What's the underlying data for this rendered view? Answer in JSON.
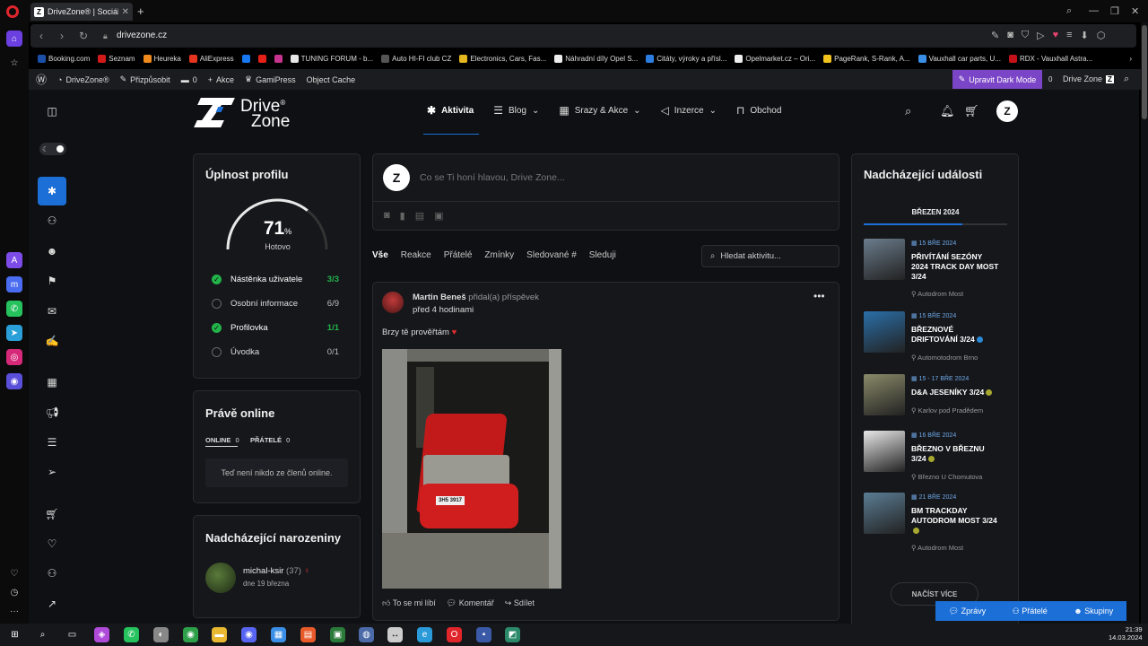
{
  "browser": {
    "tab_title": "DriveZone® | Sociální síť",
    "url": "drivezone.cz",
    "bookmarks": [
      {
        "label": "Booking.com",
        "color": "#1b4fa8"
      },
      {
        "label": "Seznam",
        "color": "#d21a1a"
      },
      {
        "label": "Heureka",
        "color": "#f08a1c"
      },
      {
        "label": "AliExpress",
        "color": "#e6341f"
      },
      {
        "label": "",
        "color": "#1877f2"
      },
      {
        "label": "",
        "color": "#e62117"
      },
      {
        "label": "",
        "color": "#c8338f"
      },
      {
        "label": "TUNING FORUM - b...",
        "color": "#e6e6e6"
      },
      {
        "label": "Auto HI-FI club CZ",
        "color": "#555"
      },
      {
        "label": "Electronics, Cars, Fas...",
        "color": "#e6b81f"
      },
      {
        "label": "Náhradní díly Opel S...",
        "color": "#eee"
      },
      {
        "label": "Citáty, výroky a přísl...",
        "color": "#2b7de0"
      },
      {
        "label": "Opelmarket.cz – Ori...",
        "color": "#eee"
      },
      {
        "label": "PageRank, S-Rank, A...",
        "color": "#f2c21d"
      },
      {
        "label": "Vauxhall car parts, U...",
        "color": "#3a8ee6"
      },
      {
        "label": "RDX - Vauxhall Astra...",
        "color": "#c4121a"
      }
    ]
  },
  "wpbar": {
    "site_name": "DriveZone®",
    "customize": "Přizpůsobit",
    "comments": "0",
    "new": "Akce",
    "gamipress": "GamiPress",
    "object_cache": "Object Cache",
    "dark_mode": "Upravit Dark Mode",
    "count": "0",
    "user": "Drive Zone"
  },
  "logo": {
    "line1": "Drive",
    "line2": "Zone",
    "reg": "®"
  },
  "nav": {
    "activity": "Aktivita",
    "blog": "Blog",
    "events": "Srazy & Akce",
    "ads": "Inzerce",
    "shop": "Obchod"
  },
  "profile_completion": {
    "title": "Úplnost profilu",
    "percent": 71,
    "percent_sign": "%",
    "done_label": "Hotovo",
    "items": [
      {
        "label": "Nástěnka uživatele",
        "count": "3/3",
        "done": true
      },
      {
        "label": "Osobní informace",
        "count": "6/9",
        "done": false
      },
      {
        "label": "Profilovka",
        "count": "1/1",
        "done": true
      },
      {
        "label": "Úvodka",
        "count": "0/1",
        "done": false
      }
    ]
  },
  "online": {
    "title": "Právě online",
    "tab_online": "ONLINE",
    "tab_online_count": "0",
    "tab_friends": "PŘÁTELÉ",
    "tab_friends_count": "0",
    "empty": "Teď není nikdo ze členů online."
  },
  "birthdays": {
    "title": "Nadcházející narozeniny",
    "name": "michal-ksir",
    "age": "(37)",
    "date": "dne 19 března"
  },
  "composer": {
    "placeholder": "Co se Ti honí hlavou, Drive Zone..."
  },
  "feed_tabs": [
    "Vše",
    "Reakce",
    "Přátelé",
    "Zmínky",
    "Sledované #",
    "Sleduji"
  ],
  "feed_search": "Hledat aktivitu...",
  "post": {
    "author": "Martin Beneš",
    "action": "přidal(a) příspěvek",
    "time": "před 4 hodinami",
    "text": "Brzy tě prověřtám",
    "plate": "3H5 3917",
    "like": "To se mi líbí",
    "comment": "Komentář",
    "share": "Sdílet"
  },
  "events": {
    "title": "Nadcházející události",
    "month": "BŘEZEN 2024",
    "more": "NAČÍST VÍCE",
    "items": [
      {
        "date": "15 BŘE 2024",
        "name": "PŘIVÍTÁNÍ SEZÓNY 2024 TRACK DAY MOST 3/24",
        "location": "Autodrom Most",
        "color": "#6b7c8c"
      },
      {
        "date": "15 BŘE 2024",
        "name": "BŘEZNOVÉ DRIFTOVÁNÍ 3/24",
        "location": "Automotodrom Brno",
        "color": "#2a6fa8"
      },
      {
        "date": "15 - 17 BŘE 2024",
        "name": "D&A JESENÍKY 3/24",
        "location": "Karlov pod Pradědem",
        "color": "#8a8a6a"
      },
      {
        "date": "16 BŘE 2024",
        "name": "BŘEZNO V BŘEZNU 3/24",
        "location": "Březno U Chomutova",
        "color": "#e8e8e8"
      },
      {
        "date": "21 BŘE 2024",
        "name": "BM TRACKDAY AUTODROM MOST 3/24",
        "location": "Autodrom Most",
        "color": "#5b7d94"
      }
    ]
  },
  "chat": {
    "messages": "Zprávy",
    "friends": "Přátelé",
    "groups": "Skupiny"
  },
  "clock": {
    "time": "21:39",
    "date": "14.03.2024"
  }
}
